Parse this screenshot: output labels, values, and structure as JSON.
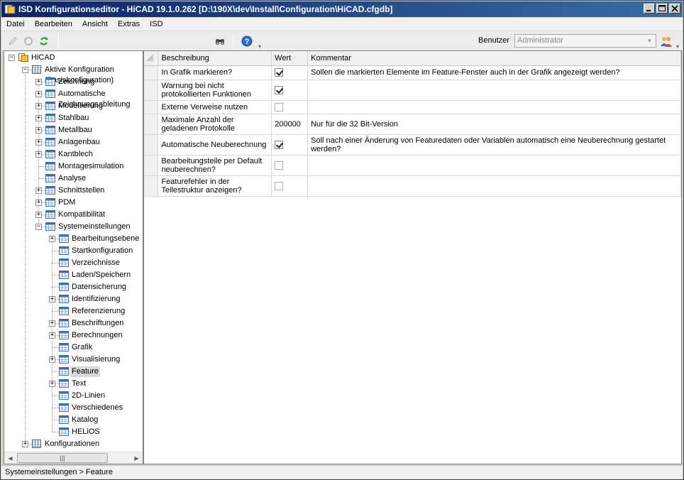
{
  "window": {
    "title": "ISD Konfigurationseditor - HiCAD 19.1.0.262 [D:\\190X\\dev\\Install\\Configuration\\HiCAD.cfgdb]"
  },
  "menu": [
    "Datei",
    "Bearbeiten",
    "Ansicht",
    "Extras",
    "ISD"
  ],
  "toolbar": {
    "user_label": "Benutzer",
    "user_value": "Administrator",
    "icons": [
      "edit-icon",
      "undo-icon",
      "refresh-icon",
      "find-icon",
      "help-icon",
      "users-icon"
    ]
  },
  "tree": {
    "root": "HiCAD",
    "active_config": "Aktive Konfiguration (Basiskonfiguration)",
    "items": [
      "Zeichnung",
      "Automatische Zeichnungsableitung",
      "Modellierung",
      "Stahlbau",
      "Metallbau",
      "Anlagenbau",
      "Kantblech",
      "Montagesimulation",
      "Analyse",
      "Schnittstellen",
      "PDM",
      "Kompatibilität",
      "Systemeinstellungen"
    ],
    "sys_items": [
      "Bearbeitungsebene",
      "Startkonfiguration",
      "Verzeichnisse",
      "Laden/Speichern",
      "Datensicherung",
      "Identifizierung",
      "Referenzierung",
      "Beschriftungen",
      "Berechnungen",
      "Grafik",
      "Visualisierung",
      "Feature",
      "Text",
      "2D-Linien",
      "Verschiedenes",
      "Katalog",
      "HELiOS"
    ],
    "configurations": "Konfigurationen",
    "selected": "Feature"
  },
  "grid": {
    "headers": [
      "Beschreibung",
      "Wert",
      "Kommentar"
    ],
    "rows": [
      {
        "desc": "In Grafik markieren?",
        "value_type": "checkbox",
        "checked": true,
        "comment": "Sollen die markierten Elemente im Feature-Fenster auch in der Grafik angezeigt werden?"
      },
      {
        "desc": "Warnung bei nicht protokollierten Funktionen",
        "value_type": "checkbox",
        "checked": true,
        "comment": ""
      },
      {
        "desc": "Externe Verweise nutzen",
        "value_type": "checkbox",
        "checked": false,
        "comment": ""
      },
      {
        "desc": "Maximale Anzahl der geladenen Protokolle",
        "value_type": "text",
        "value": "200000",
        "comment": "Nur für die 32 Bit-Version"
      },
      {
        "desc": "Automatische Neuberechnung",
        "value_type": "checkbox",
        "checked": true,
        "comment": "Soll nach einer Änderung von Featuredaten oder Variablen automatisch eine Neuberechnung gestartet werden?"
      },
      {
        "desc": "Bearbeitungsteile per Default neuberechnen?",
        "value_type": "checkbox",
        "checked": false,
        "comment": ""
      },
      {
        "desc": "Featurefehler in der Teilestruktur anzeigen?",
        "value_type": "checkbox",
        "checked": false,
        "comment": ""
      }
    ]
  },
  "status": {
    "path": "Systemeinstellungen > Feature"
  }
}
